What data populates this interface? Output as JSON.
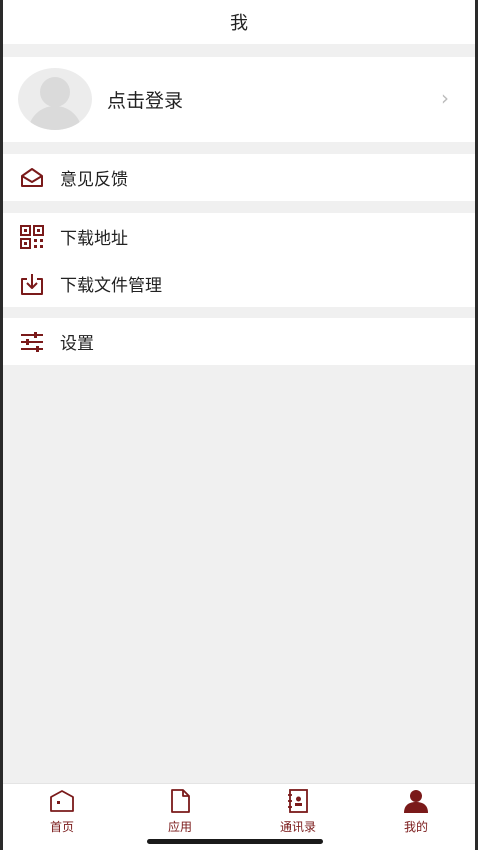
{
  "header": {
    "title": "我"
  },
  "profile": {
    "login_text": "点击登录",
    "chevron": "›"
  },
  "menu": {
    "feedback": {
      "label": "意见反馈",
      "icon": "mail-open-icon"
    },
    "download_address": {
      "label": "下载地址",
      "icon": "qr-code-icon"
    },
    "download_manager": {
      "label": "下载文件管理",
      "icon": "download-tray-icon"
    },
    "settings": {
      "label": "设置",
      "icon": "sliders-icon"
    }
  },
  "tabbar": {
    "tabs": [
      {
        "label": "首页",
        "icon": "home-icon"
      },
      {
        "label": "应用",
        "icon": "document-icon"
      },
      {
        "label": "通讯录",
        "icon": "contacts-book-icon"
      },
      {
        "label": "我的",
        "icon": "user-icon",
        "active": true
      }
    ]
  },
  "colors": {
    "accent": "#7a1a1a",
    "background": "#f0f0f0",
    "card": "#ffffff"
  }
}
